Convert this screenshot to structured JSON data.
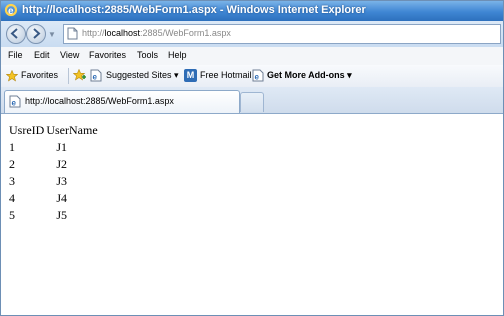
{
  "window": {
    "title": "http://localhost:2885/WebForm1.aspx - Windows Internet Explorer"
  },
  "address": {
    "prefix": "http://",
    "host": "localhost",
    "rest": ":2885/WebForm1.aspx"
  },
  "menu": [
    "File",
    "Edit",
    "View",
    "Favorites",
    "Tools",
    "Help"
  ],
  "favorites_bar": {
    "favorites_label": "Favorites",
    "suggested_sites_label": "Suggested Sites ▾",
    "hotmail_label": "Free Hotmail",
    "addons_label": "Get More Add-ons ▾"
  },
  "tabs": [
    {
      "label": "http://localhost:2885/WebForm1.aspx"
    }
  ],
  "grid": {
    "headers": [
      "UsreID",
      "UserName"
    ],
    "rows": [
      [
        "1",
        "J1"
      ],
      [
        "2",
        "J2"
      ],
      [
        "3",
        "J3"
      ],
      [
        "4",
        "J4"
      ],
      [
        "5",
        "J5"
      ]
    ]
  },
  "colors": {
    "titlebar": "#3f86d3",
    "toolbar": "#dce9f7"
  }
}
